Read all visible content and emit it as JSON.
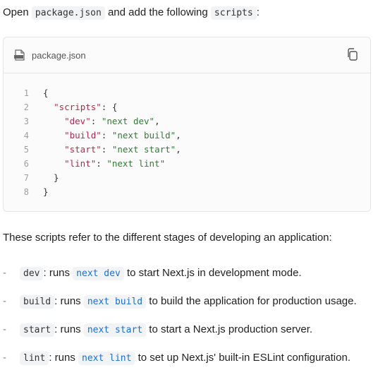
{
  "intro": {
    "open": "Open",
    "file": "package.json",
    "mid": "and add the following",
    "scripts": "scripts",
    "colon": ":"
  },
  "code_block": {
    "filename": "package.json",
    "icons": {
      "file": "file-icon",
      "copy": "copy-icon"
    },
    "lines": [
      {
        "n": "1",
        "parts": [
          {
            "t": "{",
            "c": "p"
          }
        ]
      },
      {
        "n": "2",
        "parts": [
          {
            "t": "  ",
            "c": "p"
          },
          {
            "t": "\"scripts\"",
            "c": "k"
          },
          {
            "t": ": {",
            "c": "p"
          }
        ]
      },
      {
        "n": "3",
        "parts": [
          {
            "t": "    ",
            "c": "p"
          },
          {
            "t": "\"dev\"",
            "c": "k"
          },
          {
            "t": ": ",
            "c": "p"
          },
          {
            "t": "\"next dev\"",
            "c": "s"
          },
          {
            "t": ",",
            "c": "p"
          }
        ]
      },
      {
        "n": "4",
        "parts": [
          {
            "t": "    ",
            "c": "p"
          },
          {
            "t": "\"build\"",
            "c": "k"
          },
          {
            "t": ": ",
            "c": "p"
          },
          {
            "t": "\"next build\"",
            "c": "s"
          },
          {
            "t": ",",
            "c": "p"
          }
        ]
      },
      {
        "n": "5",
        "parts": [
          {
            "t": "    ",
            "c": "p"
          },
          {
            "t": "\"start\"",
            "c": "k"
          },
          {
            "t": ": ",
            "c": "p"
          },
          {
            "t": "\"next start\"",
            "c": "s"
          },
          {
            "t": ",",
            "c": "p"
          }
        ]
      },
      {
        "n": "6",
        "parts": [
          {
            "t": "    ",
            "c": "p"
          },
          {
            "t": "\"lint\"",
            "c": "k"
          },
          {
            "t": ": ",
            "c": "p"
          },
          {
            "t": "\"next lint\"",
            "c": "s"
          }
        ]
      },
      {
        "n": "7",
        "parts": [
          {
            "t": "  }",
            "c": "p"
          }
        ]
      },
      {
        "n": "8",
        "parts": [
          {
            "t": "}",
            "c": "p"
          }
        ]
      }
    ]
  },
  "paragraph": "These scripts refer to the different stages of developing an application:",
  "list": [
    {
      "dash": "-",
      "code": "dev",
      "sep": ": runs",
      "cmd": "next dev",
      "desc": "to start Next.js in development mode."
    },
    {
      "dash": "-",
      "code": "build",
      "sep": ": runs",
      "cmd": "next build",
      "desc": "to build the application for production usage."
    },
    {
      "dash": "-",
      "code": "start",
      "sep": ": runs",
      "cmd": "next start",
      "desc": "to start a Next.js production server."
    },
    {
      "dash": "-",
      "code": "lint",
      "sep": ": runs",
      "cmd": "next lint",
      "desc": "to set up Next.js' built-in ESLint configuration."
    }
  ]
}
